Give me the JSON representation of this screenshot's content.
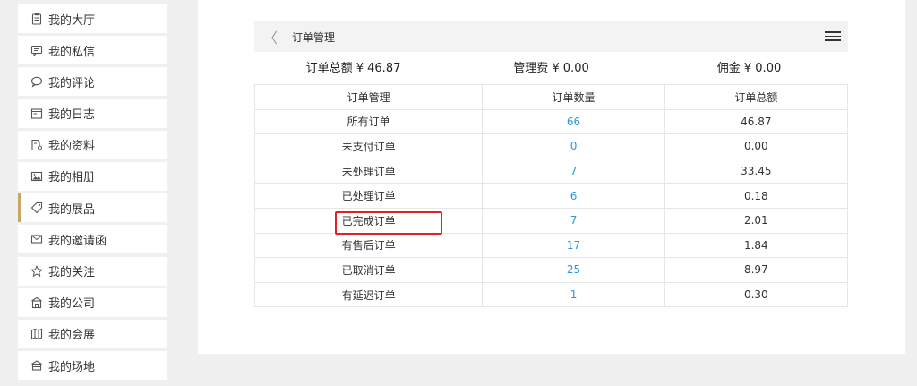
{
  "sidebar": {
    "active_index": 6,
    "accent_color": "#c8a866",
    "items": [
      {
        "label": "我的大厅",
        "icon": "clipboard-icon"
      },
      {
        "label": "我的私信",
        "icon": "message-icon"
      },
      {
        "label": "我的评论",
        "icon": "comment-icon"
      },
      {
        "label": "我的日志",
        "icon": "journal-icon"
      },
      {
        "label": "我的资料",
        "icon": "profile-doc-icon"
      },
      {
        "label": "我的相册",
        "icon": "photo-icon"
      },
      {
        "label": "我的展品",
        "icon": "tag-icon"
      },
      {
        "label": "我的邀请函",
        "icon": "envelope-icon"
      },
      {
        "label": "我的关注",
        "icon": "star-icon"
      },
      {
        "label": "我的公司",
        "icon": "building-icon"
      },
      {
        "label": "我的会展",
        "icon": "map-icon"
      },
      {
        "label": "我的场地",
        "icon": "venue-icon"
      }
    ]
  },
  "header": {
    "back_symbol": "〈",
    "title": "订单管理"
  },
  "summary": {
    "total": "订单总额 ¥ 46.87",
    "fee": "管理费 ¥ 0.00",
    "commission": "佣金 ¥ 0.00"
  },
  "table": {
    "headers": [
      "订单管理",
      "订单数量",
      "订单总额"
    ],
    "count_color": "#2a9ad6",
    "rows": [
      {
        "name": "所有订单",
        "count": "66",
        "total": "46.87"
      },
      {
        "name": "未支付订单",
        "count": "0",
        "total": "0.00"
      },
      {
        "name": "未处理订单",
        "count": "7",
        "total": "33.45"
      },
      {
        "name": "已处理订单",
        "count": "6",
        "total": "0.18"
      },
      {
        "name": "已完成订单",
        "count": "7",
        "total": "2.01"
      },
      {
        "name": "有售后订单",
        "count": "17",
        "total": "1.84"
      },
      {
        "name": "已取消订单",
        "count": "25",
        "total": "8.97"
      },
      {
        "name": "有延迟订单",
        "count": "1",
        "total": "0.30"
      }
    ]
  },
  "highlight_color": "#e02222"
}
